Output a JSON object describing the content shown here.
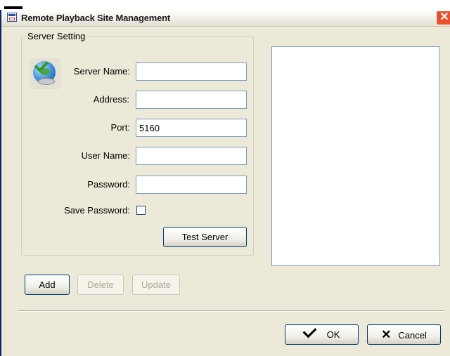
{
  "window": {
    "title": "Remote Playback Site Management",
    "close_glyph": "✕"
  },
  "server_setting": {
    "legend": "Server Setting",
    "icon": "server-globe-check-icon",
    "labels": {
      "server_name": "Server Name:",
      "address": "Address:",
      "port": "Port:",
      "user_name": "User Name:",
      "password": "Password:",
      "save_password": "Save Password:"
    },
    "values": {
      "server_name": "",
      "address": "",
      "port": "5160",
      "user_name": "",
      "password": ""
    },
    "save_password_checked": false,
    "test_button": "Test Server"
  },
  "actions": {
    "add": "Add",
    "delete": "Delete",
    "update": "Update"
  },
  "dialog_buttons": {
    "ok": "OK",
    "cancel": "Cancel"
  },
  "colors": {
    "dialog_bg": "#ece9d8",
    "border_blue": "#003c74",
    "close_red": "#e8502e"
  }
}
